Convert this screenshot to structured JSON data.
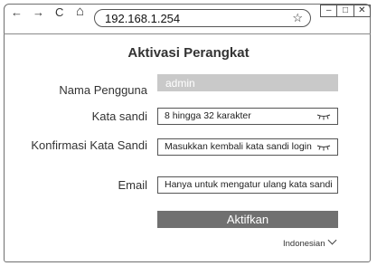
{
  "browser": {
    "back_icon": "←",
    "forward_icon": "→",
    "reload_icon": "C",
    "home_icon": "⌂",
    "address": "192.168.1.254",
    "bookmark_icon": "☆",
    "window_controls": {
      "minimize": "–",
      "maximize": "□",
      "close": "✕"
    }
  },
  "page": {
    "title": "Aktivasi Perangkat",
    "fields": {
      "username": {
        "label": "Nama Pengguna",
        "value": "admin"
      },
      "password": {
        "label": "Kata sandi",
        "placeholder": "8 hingga 32 karakter"
      },
      "confirm": {
        "label": "Konfirmasi Kata Sandi",
        "placeholder": "Masukkan kembali kata sandi login"
      },
      "email": {
        "label": "Email",
        "placeholder": "Hanya untuk mengatur ulang kata sandi"
      }
    },
    "submit_label": "Aktifkan",
    "language": "Indonesian"
  }
}
